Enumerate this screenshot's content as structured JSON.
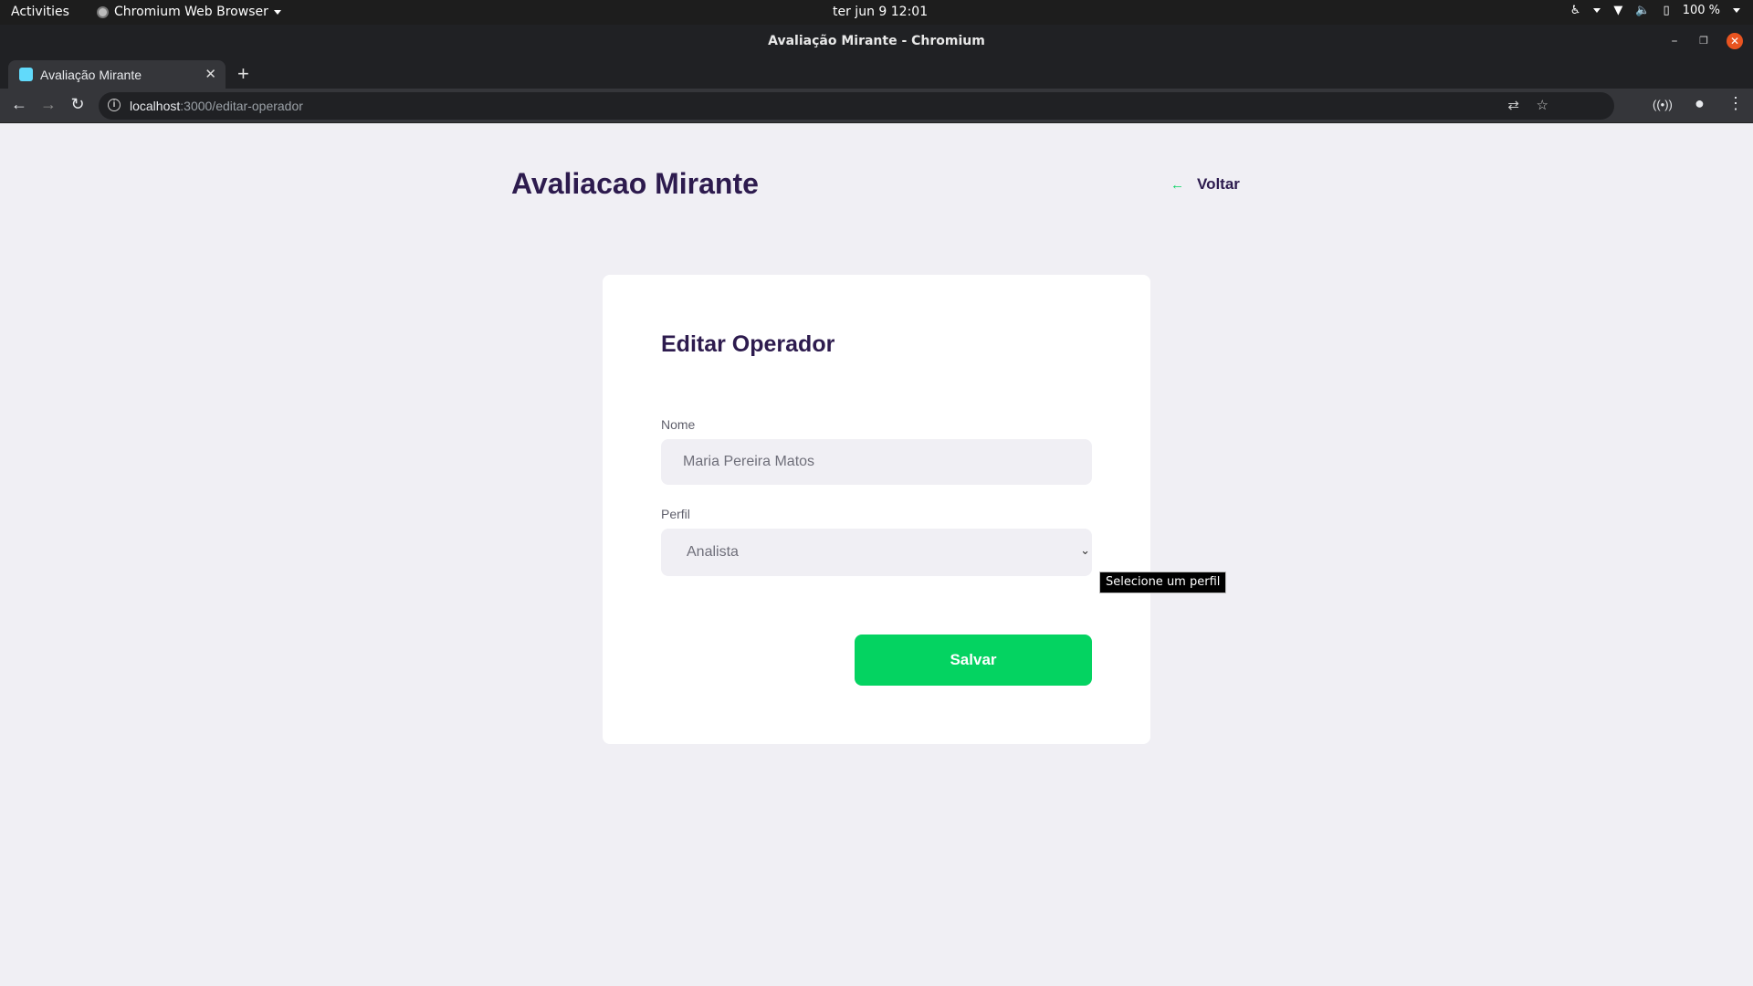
{
  "system": {
    "activities": "Activities",
    "app_name": "Chromium Web Browser",
    "clock": "ter jun 9  12:01",
    "battery": "100 %"
  },
  "window": {
    "title": "Avaliação Mirante - Chromium"
  },
  "browser": {
    "tab_title": "Avaliação Mirante",
    "url_host": "localhost",
    "url_path": ":3000/editar-operador"
  },
  "page": {
    "title": "Avaliacao Mirante",
    "back_label": "Voltar"
  },
  "form": {
    "heading": "Editar Operador",
    "nome_label": "Nome",
    "nome_value": "Maria Pereira Matos",
    "perfil_label": "Perfil",
    "perfil_value": "Analista",
    "perfil_tooltip": "Selecione um perfil",
    "save_label": "Salvar"
  },
  "colors": {
    "accent_green": "#04d361",
    "heading_purple": "#2d1b4e",
    "page_bg": "#f0eff4"
  },
  "icons": {
    "back_link": "arrow-left-icon",
    "select": "chevron-down-icon"
  }
}
